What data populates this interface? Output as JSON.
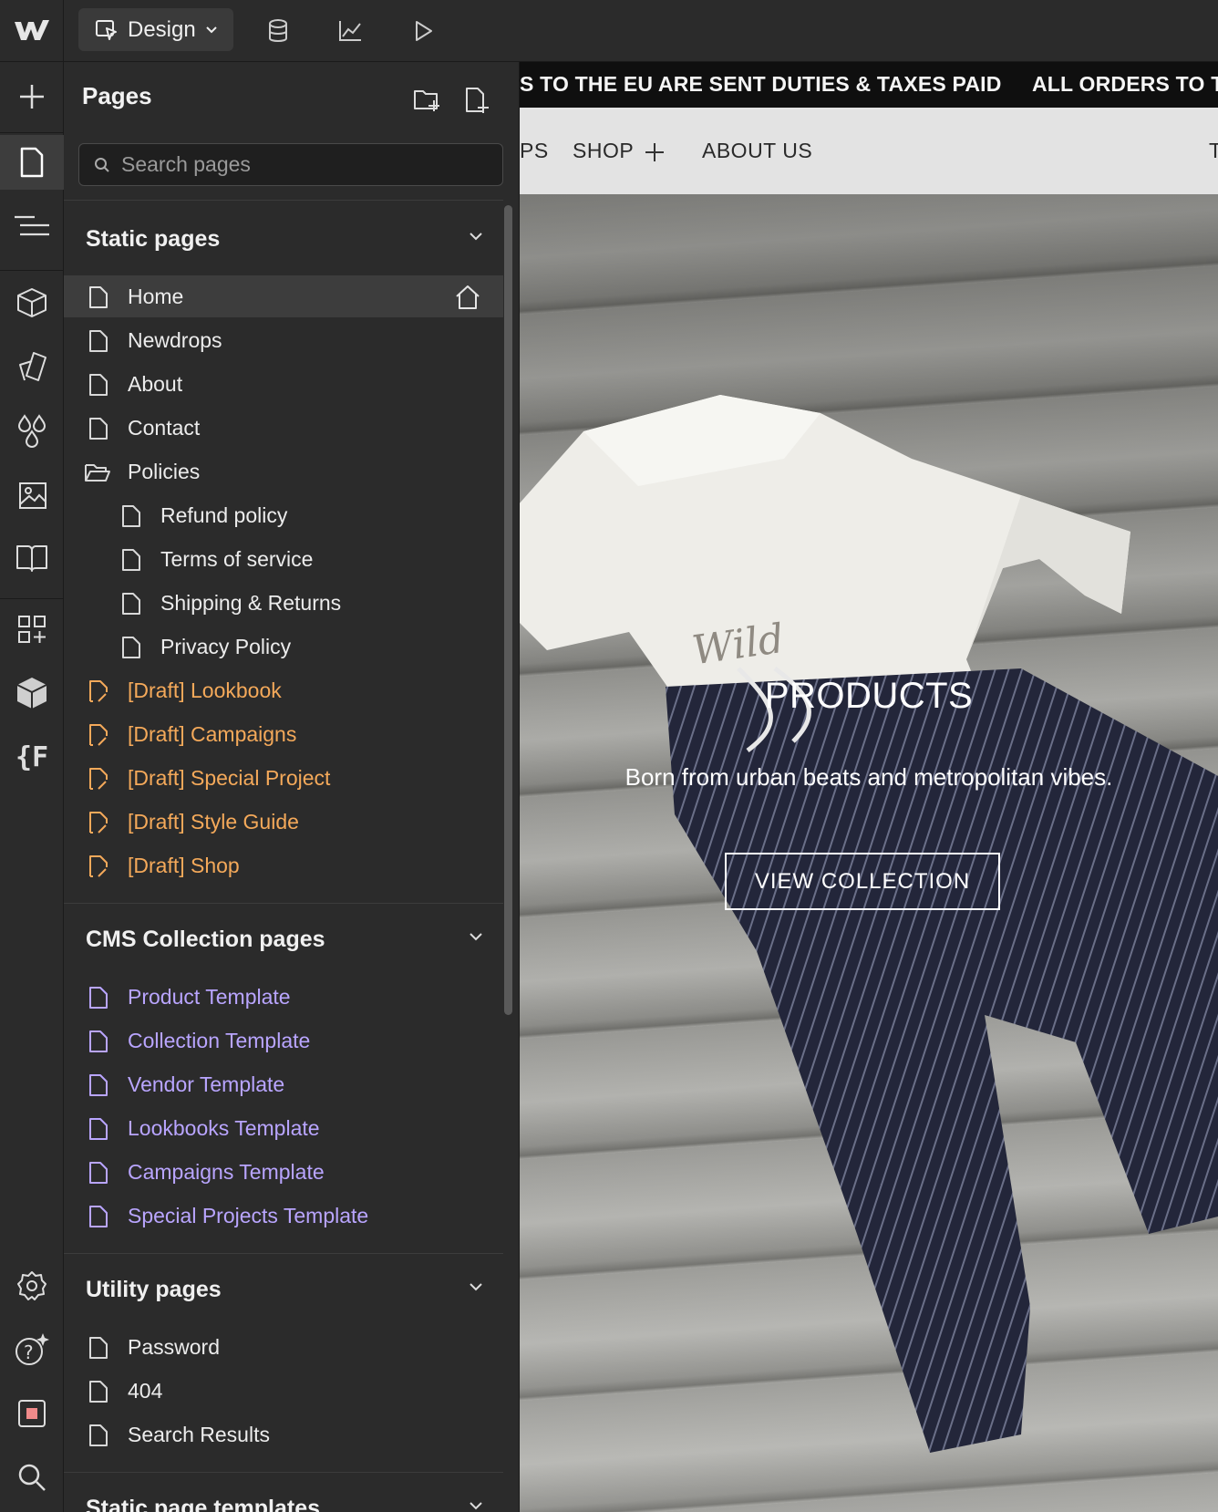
{
  "topbar": {
    "mode_label": "Design",
    "icons": [
      "webflow-logo-icon",
      "cursor-square-icon",
      "chevron-down-icon",
      "database-icon",
      "analytics-icon",
      "play-icon"
    ]
  },
  "rail": {
    "icons": [
      "plus-icon",
      "page-icon",
      "navigator-icon",
      "components-icon",
      "styles-icon",
      "variables-icon",
      "assets-icon",
      "book-icon",
      "apps-icon",
      "cube-icon",
      "formulas-icon",
      "settings-icon",
      "help-icon",
      "stop-icon",
      "search-icon"
    ],
    "formulas_label": "{F"
  },
  "pages_panel": {
    "title": "Pages",
    "search_placeholder": "Search pages",
    "sections": {
      "static": {
        "label": "Static pages",
        "items": [
          {
            "label": "Home",
            "type": "page",
            "selected": true
          },
          {
            "label": "Newdrops",
            "type": "page"
          },
          {
            "label": "About",
            "type": "page"
          },
          {
            "label": "Contact",
            "type": "page"
          },
          {
            "label": "Policies",
            "type": "folder"
          },
          {
            "label": "Refund policy",
            "type": "page",
            "indent": 1
          },
          {
            "label": "Terms of service",
            "type": "page",
            "indent": 1
          },
          {
            "label": "Shipping & Returns",
            "type": "page",
            "indent": 1
          },
          {
            "label": "Privacy Policy",
            "type": "page",
            "indent": 1
          },
          {
            "label": "[Draft] Lookbook",
            "type": "draft"
          },
          {
            "label": "[Draft] Campaigns",
            "type": "draft"
          },
          {
            "label": "[Draft] Special Project",
            "type": "draft"
          },
          {
            "label": "[Draft] Style Guide",
            "type": "draft"
          },
          {
            "label": "[Draft] Shop",
            "type": "draft"
          }
        ]
      },
      "cms": {
        "label": "CMS Collection pages",
        "items": [
          {
            "label": "Product Template"
          },
          {
            "label": "Collection Template"
          },
          {
            "label": "Vendor Template"
          },
          {
            "label": "Lookbooks Template"
          },
          {
            "label": "Campaigns Template"
          },
          {
            "label": "Special Projects Template"
          }
        ]
      },
      "utility": {
        "label": "Utility pages",
        "items": [
          {
            "label": "Password"
          },
          {
            "label": "404"
          },
          {
            "label": "Search Results"
          }
        ]
      },
      "templates": {
        "label": "Static page templates"
      }
    }
  },
  "canvas": {
    "announcement": [
      "S TO THE EU ARE SENT DUTIES & TAXES PAID",
      "ALL ORDERS TO T"
    ],
    "nav": [
      "PS",
      "SHOP",
      "ABOUT US",
      "T"
    ],
    "hero": {
      "title": "PRODUCTS",
      "subtitle": "Born from urban beats and metropolitan vibes.",
      "button": "VIEW COLLECTION",
      "shirt_print": "Wild"
    }
  }
}
